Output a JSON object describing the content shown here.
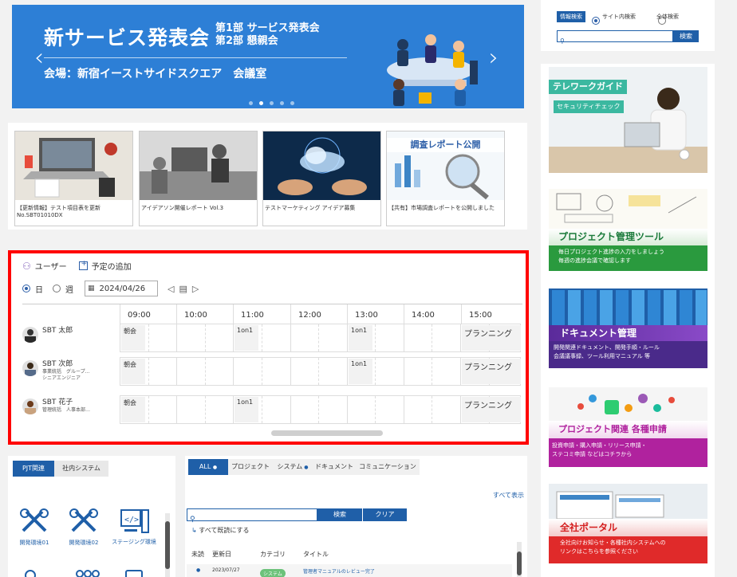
{
  "banner": {
    "title": "新サービス発表会",
    "sub1": "第1部 サービス発表会",
    "sub2": "第2部 懇親会",
    "venue": "会場：新宿イーストサイドスクエア　会議室",
    "prev": "‹",
    "next": "›",
    "colors": {
      "bg": "#2d7fd6"
    }
  },
  "cards": [
    {
      "caption": "【更新情報】テスト項目表を更新 No.SBT01010DX"
    },
    {
      "caption": "アイデアソン開催レポート Vol.3"
    },
    {
      "caption": "テストマーケティング アイデア募集"
    },
    {
      "caption": "【共有】市場調査レポートを公開しました",
      "overlay": "調査レポート公開"
    }
  ],
  "schedule": {
    "users_label": "ユーザー",
    "add_label": "予定の追加",
    "day_label": "日",
    "week_label": "週",
    "date": "2024/04/26",
    "times": [
      "09:00",
      "10:00",
      "11:00",
      "12:00",
      "13:00",
      "14:00",
      "15:00"
    ],
    "people": [
      {
        "name": "SBT 太郎",
        "dept": "",
        "dept2": ""
      },
      {
        "name": "SBT 次郎",
        "dept": "事業統括　グループ…",
        "dept2": "シニアエンジニア"
      },
      {
        "name": "SBT 花子",
        "dept": "管理統括　人事本部…",
        "dept2": ""
      }
    ],
    "events": {
      "morning": "朝会",
      "one_on_one": "1on1",
      "planning": "プランニング"
    }
  },
  "pjt": {
    "tab1": "PJT関連",
    "tab2": "社内システム",
    "items": [
      "開発環境01",
      "開発環境02",
      "ステージング環境"
    ]
  },
  "news": {
    "tabs": [
      "ALL",
      "プロジェクト",
      "システム",
      "ドキュメント",
      "コミュニケーション"
    ],
    "show_all": "すべて表示",
    "search_btn": "検索",
    "clear_btn": "クリア",
    "mark_read": "すべて既読にする",
    "cols": [
      "未読",
      "更新日",
      "カテゴリ",
      "タイトル"
    ],
    "row": {
      "date": "2023/07/27",
      "cat": "システム",
      "title": "管理者マニュアルのレビュー完了"
    }
  },
  "search": {
    "label": "情報検索",
    "opt1": "サイト内検索",
    "opt2": "全体検索",
    "button": "検索"
  },
  "promos": [
    {
      "title": "テレワークガイド",
      "sub": "セキュリティチェック"
    },
    {
      "title": "プロジェクト管理ツール",
      "desc1": "毎日プロジェクト進捗の入力をしましょう",
      "desc2": "毎週の進捗会議で確認します"
    },
    {
      "title": "ドキュメント管理",
      "desc1": "開発関連ドキュメント、開発手順・ルール",
      "desc2": "会議議事録、ツール利用マニュアル 等"
    },
    {
      "title": "プロジェクト関連 各種申請",
      "desc1": "投資申請・購入申請・リリース申請・",
      "desc2": "ステコミ申請 などはコチラから"
    },
    {
      "title": "全社ポータル",
      "desc1": "全社向けお知らせ・各種社内システムへの",
      "desc2": "リンクはこちらを参照ください"
    }
  ]
}
